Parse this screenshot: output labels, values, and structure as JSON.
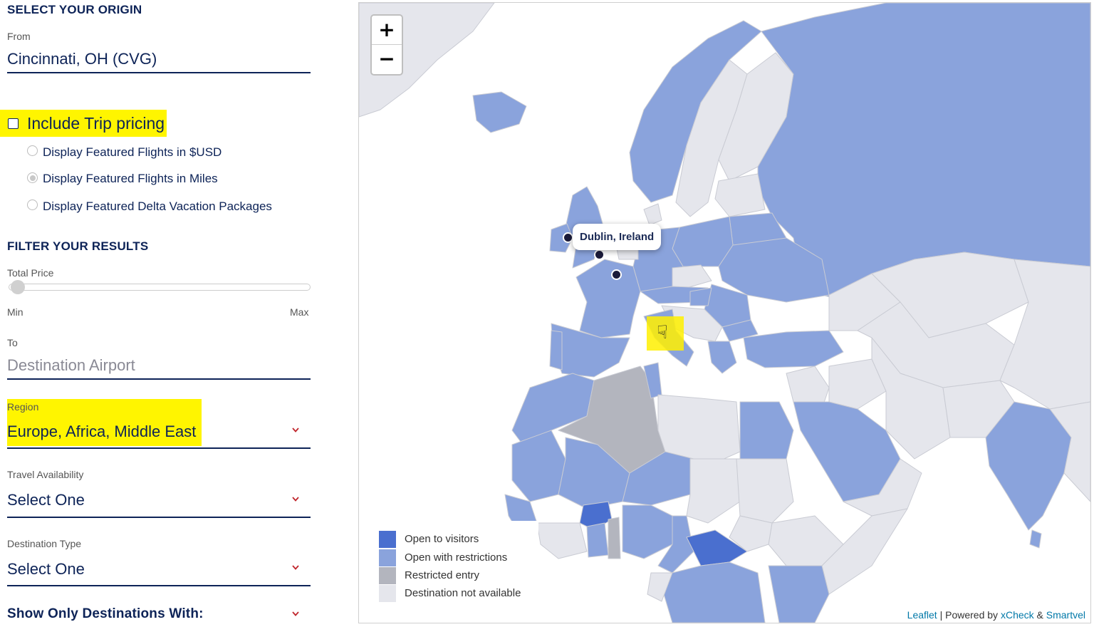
{
  "origin": {
    "section_title": "SELECT YOUR ORIGIN",
    "from_label": "From",
    "from_value": "Cincinnati, OH (CVG)"
  },
  "trip_pricing": {
    "label": "Include Trip pricing",
    "checked": false,
    "options": [
      {
        "label": "Display Featured Flights in $USD",
        "selected": false
      },
      {
        "label": "Display Featured Flights in Miles",
        "selected": true
      },
      {
        "label": "Display Featured Delta Vacation Packages",
        "selected": false
      }
    ]
  },
  "filter": {
    "section_title": "FILTER YOUR RESULTS",
    "total_price_label": "Total Price",
    "slider_value": 0,
    "min_label": "Min",
    "max_label": "Max",
    "to_label": "To",
    "destination_placeholder": "Destination Airport",
    "region_label": "Region",
    "region_value": "Europe, Africa, Middle East",
    "travel_label": "Travel Availability",
    "travel_value": "Select One",
    "dest_type_label": "Destination Type",
    "dest_type_value": "Select One",
    "show_only_label": "Show Only Destinations With:"
  },
  "map": {
    "zoom_in": "+",
    "zoom_out": "−",
    "popup_text": "Dublin, Ireland",
    "legend": [
      {
        "label": "Open to visitors",
        "color": "#4a6fcf"
      },
      {
        "label": "Open with restrictions",
        "color": "#8aa3dc"
      },
      {
        "label": "Restricted entry",
        "color": "#b3b5be"
      },
      {
        "label": "Destination not available",
        "color": "#e5e6ec"
      }
    ],
    "attribution": {
      "leaflet": "Leaflet",
      "sep": " | ",
      "powered": "Powered by ",
      "xcheck": "xCheck",
      "amp": " & ",
      "smartvel": "Smartvel"
    },
    "colors": {
      "open": "#4a6fcf",
      "restrictions": "#8aa3dc",
      "restricted": "#b3b5be",
      "unavailable": "#e5e6ec",
      "border": "#c9cbd3"
    },
    "cursor_icon": "hand-cursor-icon"
  }
}
